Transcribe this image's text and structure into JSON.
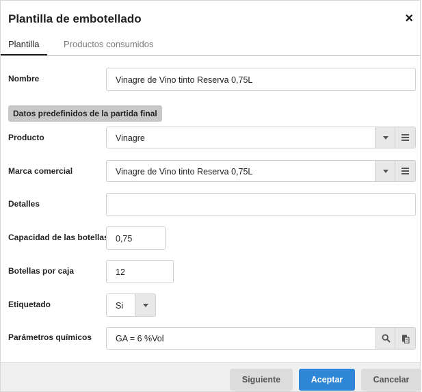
{
  "dialog": {
    "title": "Plantilla de embotellado",
    "close_symbol": "×"
  },
  "tabs": [
    {
      "label": "Plantilla",
      "active": true
    },
    {
      "label": "Productos consumidos",
      "active": false
    }
  ],
  "form": {
    "nombre": {
      "label": "Nombre",
      "value": "Vinagre de Vino tinto Reserva 0,75L"
    },
    "section_title": "Datos predefinidos de la partida final",
    "producto": {
      "label": "Producto",
      "value": "Vinagre"
    },
    "marca": {
      "label": "Marca comercial",
      "value": "Vinagre de Vino tinto Reserva 0,75L"
    },
    "detalles": {
      "label": "Detalles",
      "value": ""
    },
    "capacidad": {
      "label": "Capacidad de las botellas",
      "value": "0,75"
    },
    "botellas": {
      "label": "Botellas por caja",
      "value": "12"
    },
    "etiquetado": {
      "label": "Etiquetado",
      "value": "Si"
    },
    "parametros": {
      "label": "Parámetros químicos",
      "value": "GA = 6 %Vol"
    }
  },
  "footer": {
    "siguiente": "Siguiente",
    "aceptar": "Aceptar",
    "cancelar": "Cancelar"
  },
  "colors": {
    "primary": "#2f86d6",
    "secondary_button": "#dcdcdc",
    "section_badge": "#c8c8c8"
  },
  "icons": [
    "close-icon",
    "caret-down-icon",
    "list-icon",
    "search-icon",
    "paste-icon"
  ]
}
